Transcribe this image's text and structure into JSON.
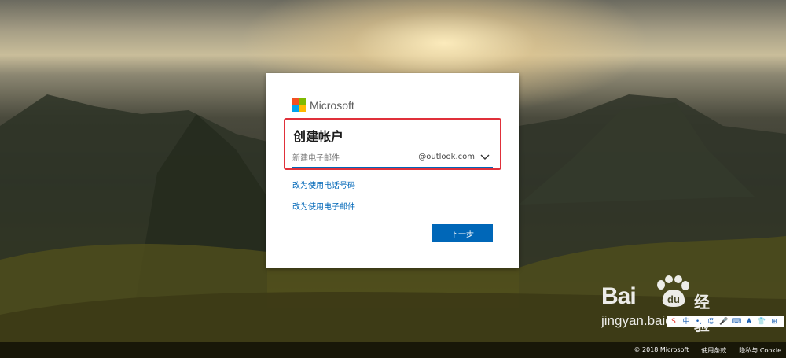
{
  "brand": {
    "name": "Microsoft"
  },
  "dialog": {
    "title": "创建帐户",
    "email": {
      "placeholder": "新建电子邮件",
      "value": "",
      "domain": "@outlook.com"
    },
    "links": {
      "use_phone": "改为使用电话号码",
      "use_email": "改为使用电子邮件"
    },
    "next_label": "下一步"
  },
  "colors": {
    "accent": "#0067b8",
    "highlight_border": "#e0303a"
  },
  "watermark": {
    "brand_latin": "Bai",
    "brand_cn": "经验",
    "url": "jingyan.baidu.com"
  },
  "ime_toolbar": {
    "items": [
      {
        "glyph": "S",
        "color": "#e8322a"
      },
      {
        "glyph": "中",
        "color": "#1a5fb4"
      },
      {
        "glyph": "•,",
        "color": "#1a5fb4"
      },
      {
        "glyph": "☺",
        "color": "#1a5fb4"
      },
      {
        "glyph": "🎤",
        "color": "#1a5fb4"
      },
      {
        "glyph": "⌨",
        "color": "#1a5fb4"
      },
      {
        "glyph": "♣",
        "color": "#1a5fb4"
      },
      {
        "glyph": "👕",
        "color": "#1a5fb4"
      },
      {
        "glyph": "⊞",
        "color": "#1a5fb4"
      }
    ]
  },
  "footer": {
    "copyright": "© 2018 Microsoft",
    "terms": "使用条款",
    "privacy": "隐私与 Cookie"
  }
}
